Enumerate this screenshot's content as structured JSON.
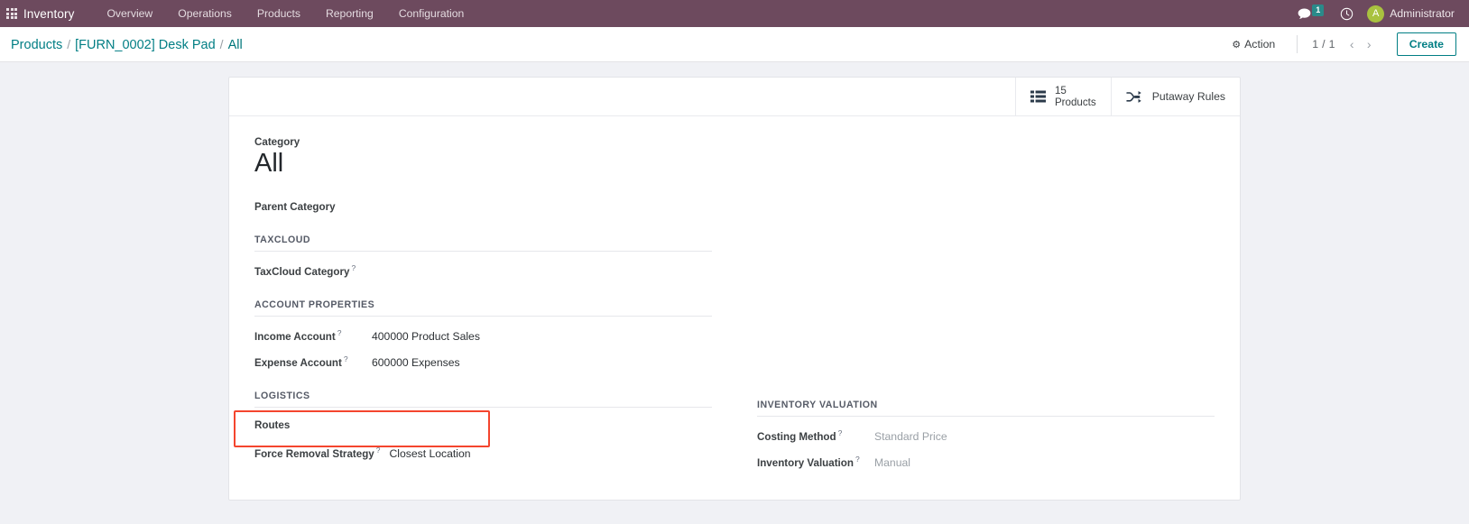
{
  "navbar": {
    "apps_icon": "apps-grid-icon",
    "brand": "Inventory",
    "menu": [
      "Overview",
      "Operations",
      "Products",
      "Reporting",
      "Configuration"
    ],
    "messages_icon": "chat-bubble-icon",
    "messages_count": "1",
    "activities_icon": "clock-icon",
    "avatar_initial": "A",
    "user_name": "Administrator",
    "brand_color": "#6d4a5e",
    "badge_color": "#2a8a8a",
    "avatar_color": "#a9c23f"
  },
  "control_bar": {
    "breadcrumb": [
      {
        "label": "Products",
        "active": false
      },
      {
        "label": "[FURN_0002] Desk Pad",
        "active": false
      },
      {
        "label": "All",
        "active": true
      }
    ],
    "separator": "/",
    "action_label": "Action",
    "action_icon": "gear-icon",
    "pager_counter": "1 / 1",
    "prev_icon": "chevron-left-icon",
    "next_icon": "chevron-right-icon",
    "create_label": "Create",
    "accent_color": "#017e84"
  },
  "stat_buttons": [
    {
      "icon": "list-view-icon",
      "value": "15",
      "label": "Products",
      "two_line": true
    },
    {
      "icon": "shuffle-icon",
      "value": "",
      "label": "Putaway Rules",
      "two_line": false
    }
  ],
  "form": {
    "category_label": "Category",
    "category_value": "All",
    "parent_category_label": "Parent Category",
    "parent_category_value": "",
    "left_column": [
      {
        "group_title": "TaxCloud",
        "rows": [
          {
            "label": "TaxCloud Category",
            "help": "?",
            "value": "",
            "muted": false
          }
        ]
      },
      {
        "group_title": "Account Properties",
        "rows": [
          {
            "label": "Income Account",
            "help": "?",
            "value": "400000 Product Sales",
            "muted": false
          },
          {
            "label": "Expense Account",
            "help": "?",
            "value": "600000 Expenses",
            "muted": false
          }
        ]
      },
      {
        "group_title": "Logistics",
        "rows": [
          {
            "label": "Routes",
            "help": "",
            "value": "",
            "muted": false
          },
          {
            "label": "Force Removal Strategy",
            "help": "?",
            "value": "Closest Location",
            "muted": false
          }
        ]
      }
    ],
    "right_column": [
      {
        "group_title": "Inventory Valuation",
        "rows": [
          {
            "label": "Costing Method",
            "help": "?",
            "value": "Standard Price",
            "muted": true
          },
          {
            "label": "Inventory Valuation",
            "help": "?",
            "value": "Manual",
            "muted": true
          }
        ]
      }
    ]
  },
  "annotation": {
    "highlight_color": "#f4452e",
    "target": "force-removal-strategy-row"
  }
}
